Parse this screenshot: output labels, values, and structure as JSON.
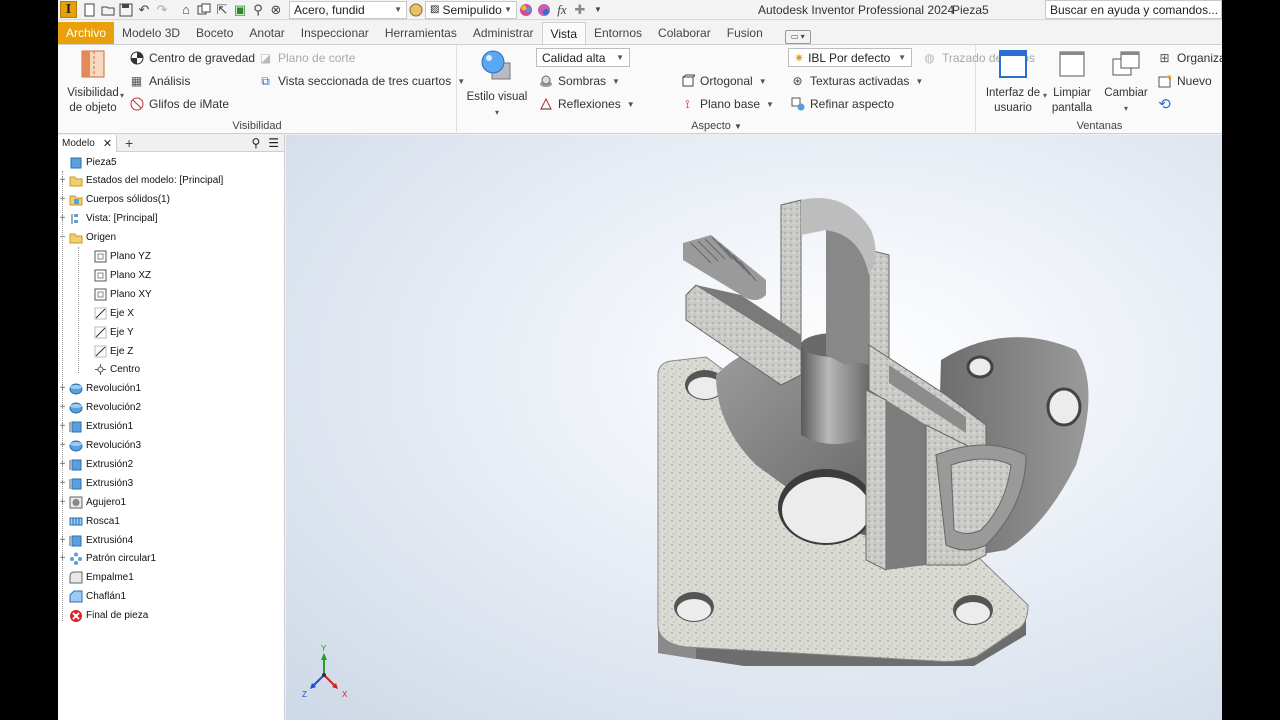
{
  "app": {
    "title": "Autodesk Inventor Professional 2024",
    "document": "Pieza5",
    "logo_letter": "I",
    "material_select": "Acero, fundid",
    "appearance_select": "Semipulido",
    "search_placeholder": "Buscar en ayuda y comandos..."
  },
  "tabs": [
    {
      "label": "Archivo"
    },
    {
      "label": "Modelo 3D"
    },
    {
      "label": "Boceto"
    },
    {
      "label": "Anotar"
    },
    {
      "label": "Inspeccionar"
    },
    {
      "label": "Herramientas"
    },
    {
      "label": "Administrar"
    },
    {
      "label": "Vista"
    },
    {
      "label": "Entornos"
    },
    {
      "label": "Colaborar"
    },
    {
      "label": "Fusion"
    }
  ],
  "ribbon": {
    "visibilidad": {
      "label": "Visibilidad",
      "visibilidad_objeto_1": "Visibilidad",
      "visibilidad_objeto_2": "de objeto",
      "centro_gravedad": "Centro de gravedad",
      "analisis": "Análisis",
      "glifos": "Glifos de iMate",
      "plano_corte": "Plano de corte",
      "vista_seccionada": "Vista seccionada de tres cuartos"
    },
    "aspecto": {
      "label": "Aspecto",
      "estilo_visual": "Estilo visual",
      "calidad": "Calidad alta",
      "sombras": "Sombras",
      "reflexiones": "Reflexiones",
      "ortogonal": "Ortogonal",
      "plano_base": "Plano base",
      "ibl": "IBL Por defecto",
      "texturas": "Texturas activadas",
      "refinar": "Refinar aspecto",
      "trazado": "Trazado de rayos"
    },
    "ventanas": {
      "label": "Ventanas",
      "interfaz_1": "Interfaz de",
      "interfaz_2": "usuario",
      "limpiar_1": "Limpiar",
      "limpiar_2": "pantalla",
      "cambiar": "Cambiar",
      "organizar": "Organizar",
      "nuevo": "Nuevo"
    }
  },
  "browser": {
    "tab": "Modelo",
    "root": "Pieza5",
    "items": [
      "Estados del modelo: [Principal]",
      "Cuerpos sólidos(1)",
      "Vista: [Principal]",
      "Origen",
      "Plano YZ",
      "Plano XZ",
      "Plano XY",
      "Eje X",
      "Eje Y",
      "Eje Z",
      "Centro",
      "Revolución1",
      "Revolución2",
      "Extrusión1",
      "Revolución3",
      "Extrusión2",
      "Extrusión3",
      "Agujero1",
      "Rosca1",
      "Extrusión4",
      "Patrón circular1",
      "Empalme1",
      "Chaflán1",
      "Final de pieza"
    ]
  },
  "triad": {
    "x": "X",
    "y": "Y",
    "z": "Z"
  },
  "colors": {
    "file_tab": "#e8a10a",
    "accent_blue": "#1d6fd1",
    "viewport_bg": "#dfe6f0",
    "error_red": "#e02020"
  }
}
